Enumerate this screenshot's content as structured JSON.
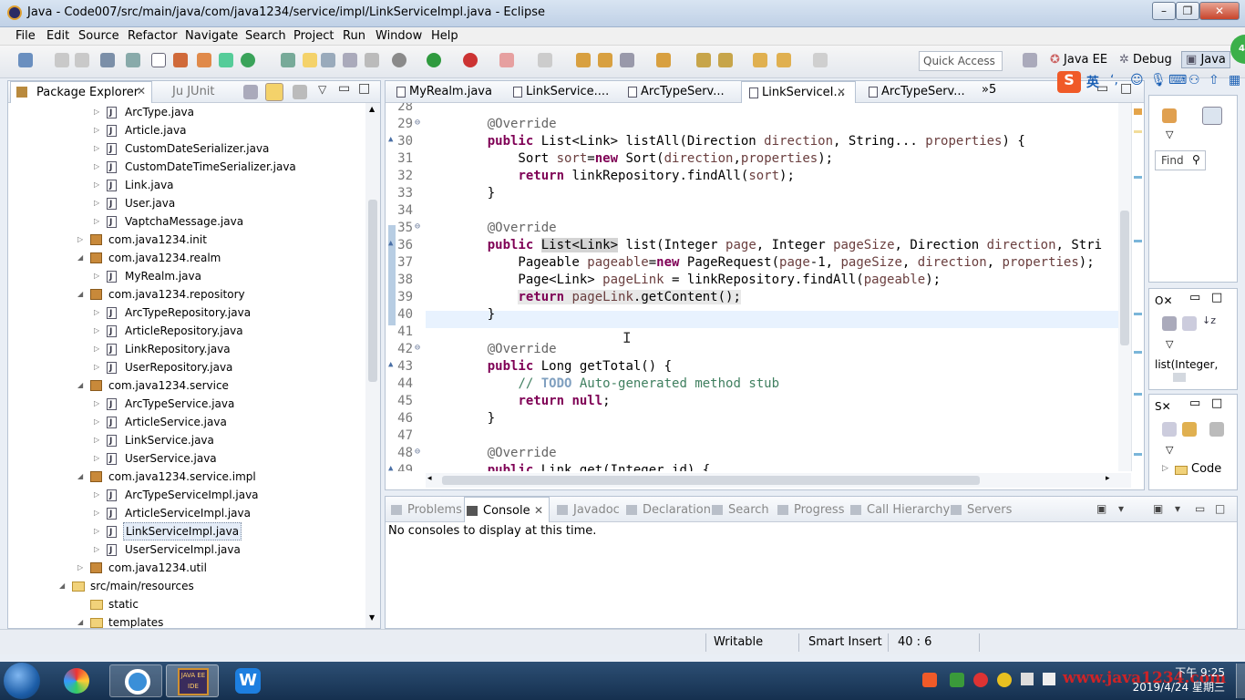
{
  "window": {
    "title": "Java - Code007/src/main/java/com/java1234/service/impl/LinkServiceImpl.java - Eclipse"
  },
  "menu": [
    "File",
    "Edit",
    "Source",
    "Refactor",
    "Navigate",
    "Search",
    "Project",
    "Run",
    "Window",
    "Help"
  ],
  "toolbar": {
    "quick_access_placeholder": "Quick Access",
    "perspectives": [
      "Java EE",
      "Debug",
      "Java"
    ],
    "badge": "40"
  },
  "package_explorer": {
    "tabs": [
      "Package Explorer",
      "JUnit"
    ],
    "items": [
      {
        "label": "ArcType.java",
        "indent": 2,
        "kind": "file"
      },
      {
        "label": "Article.java",
        "indent": 2,
        "kind": "file"
      },
      {
        "label": "CustomDateSerializer.java",
        "indent": 2,
        "kind": "file"
      },
      {
        "label": "CustomDateTimeSerializer.java",
        "indent": 2,
        "kind": "file"
      },
      {
        "label": "Link.java",
        "indent": 2,
        "kind": "file"
      },
      {
        "label": "User.java",
        "indent": 2,
        "kind": "file"
      },
      {
        "label": "VaptchaMessage.java",
        "indent": 2,
        "kind": "file"
      },
      {
        "label": "com.java1234.init",
        "indent": 1,
        "kind": "package",
        "expanded": false
      },
      {
        "label": "com.java1234.realm",
        "indent": 1,
        "kind": "package",
        "expanded": true
      },
      {
        "label": "MyRealm.java",
        "indent": 2,
        "kind": "file"
      },
      {
        "label": "com.java1234.repository",
        "indent": 1,
        "kind": "package",
        "expanded": true
      },
      {
        "label": "ArcTypeRepository.java",
        "indent": 2,
        "kind": "file"
      },
      {
        "label": "ArticleRepository.java",
        "indent": 2,
        "kind": "file"
      },
      {
        "label": "LinkRepository.java",
        "indent": 2,
        "kind": "file"
      },
      {
        "label": "UserRepository.java",
        "indent": 2,
        "kind": "file"
      },
      {
        "label": "com.java1234.service",
        "indent": 1,
        "kind": "package",
        "expanded": true
      },
      {
        "label": "ArcTypeService.java",
        "indent": 2,
        "kind": "file"
      },
      {
        "label": "ArticleService.java",
        "indent": 2,
        "kind": "file"
      },
      {
        "label": "LinkService.java",
        "indent": 2,
        "kind": "file"
      },
      {
        "label": "UserService.java",
        "indent": 2,
        "kind": "file"
      },
      {
        "label": "com.java1234.service.impl",
        "indent": 1,
        "kind": "package",
        "expanded": true
      },
      {
        "label": "ArcTypeServiceImpl.java",
        "indent": 2,
        "kind": "file"
      },
      {
        "label": "ArticleServiceImpl.java",
        "indent": 2,
        "kind": "file"
      },
      {
        "label": "LinkServiceImpl.java",
        "indent": 2,
        "kind": "file",
        "selected": true
      },
      {
        "label": "UserServiceImpl.java",
        "indent": 2,
        "kind": "file"
      },
      {
        "label": "com.java1234.util",
        "indent": 1,
        "kind": "package",
        "expanded": false
      },
      {
        "label": "src/main/resources",
        "indent": 0,
        "kind": "folder",
        "expanded": true
      },
      {
        "label": "static",
        "indent": 1,
        "kind": "folder"
      },
      {
        "label": "templates",
        "indent": 1,
        "kind": "folder",
        "expanded": true
      }
    ]
  },
  "editor_tabs": [
    {
      "label": "MyRealm.java",
      "active": false
    },
    {
      "label": "LinkService....",
      "active": false
    },
    {
      "label": "ArcTypeServ...",
      "active": false
    },
    {
      "label": "LinkServiceI...",
      "active": true
    },
    {
      "label": "ArcTypeServ...",
      "active": false
    }
  ],
  "editor_overflow": "»5",
  "code_lines": [
    {
      "n": "28",
      "html": ""
    },
    {
      "n": "29",
      "html": "    <span class='an'>@Override</span>"
    },
    {
      "n": "30",
      "html": "    <span class='kw'>public</span> List&lt;Link&gt; listAll(Direction <span class='fld'>direction</span>, String... <span class='fld'>properties</span>) {"
    },
    {
      "n": "31",
      "html": "        Sort <span class='fld'>sort</span>=<span class='kw'>new</span> Sort(<span class='fld'>direction</span>,<span class='fld'>properties</span>);"
    },
    {
      "n": "32",
      "html": "        <span class='kw'>return</span> linkRepository.findAll(<span class='fld'>sort</span>);"
    },
    {
      "n": "33",
      "html": "    }"
    },
    {
      "n": "34",
      "html": ""
    },
    {
      "n": "35",
      "html": "    <span class='an'>@Override</span>"
    },
    {
      "n": "36",
      "html": "    <span class='kw'>public</span> <span style='background:#d4d4d4'>List&lt;Link&gt;</span> list(Integer <span class='fld'>page</span>, Integer <span class='fld'>pageSize</span>, Direction <span class='fld'>direction</span>, Stri"
    },
    {
      "n": "37",
      "html": "        Pageable <span class='fld'>pageable</span>=<span class='kw'>new</span> PageRequest(<span class='fld'>page</span>-1, <span class='fld'>pageSize</span>, <span class='fld'>direction</span>, <span class='fld'>properties</span>);"
    },
    {
      "n": "38",
      "html": "        Page&lt;Link&gt; <span class='fld'>pageLink</span> = linkRepository.findAll(<span class='fld'>pageable</span>);"
    },
    {
      "n": "39",
      "html": "        <span style='background:#e8e8e8'><span class='kw'>return</span> <span class='fld'>pageLink</span>.getContent();</span>"
    },
    {
      "n": "40",
      "html": "    }"
    },
    {
      "n": "41",
      "html": ""
    },
    {
      "n": "42",
      "html": "    <span class='an'>@Override</span>"
    },
    {
      "n": "43",
      "html": "    <span class='kw'>public</span> Long getTotal() {"
    },
    {
      "n": "44",
      "html": "        <span class='cm'>// <span class='todo'>TODO</span> Auto-generated method stub</span>"
    },
    {
      "n": "45",
      "html": "        <span class='kw'>return</span> <span class='kw'>null</span>;"
    },
    {
      "n": "46",
      "html": "    }"
    },
    {
      "n": "47",
      "html": ""
    },
    {
      "n": "48",
      "html": "    <span class='an'>@Override</span>"
    },
    {
      "n": "49",
      "html": "    <span class='kw'>public</span> Link get(Integer id) {"
    }
  ],
  "bottom_tabs": [
    "Problems",
    "Console",
    "Javadoc",
    "Declaration",
    "Search",
    "Progress",
    "Call Hierarchy",
    "Servers"
  ],
  "console": {
    "message": "No consoles to display at this time."
  },
  "right_panels": {
    "find": "Find",
    "outline_tab": "O",
    "outline_item": "list(Integer,",
    "second_tab": "S",
    "second_item": "Code"
  },
  "status": {
    "writable": "Writable",
    "insert": "Smart Insert",
    "position": "40 : 6"
  },
  "ime": {
    "logo": "S",
    "lang": "英"
  },
  "taskbar": {
    "time": "下午 9:25",
    "date": "2019/4/24 星期三",
    "watermark": "www.java1234.com",
    "eclipse_label": "JAVA EE IDE"
  }
}
